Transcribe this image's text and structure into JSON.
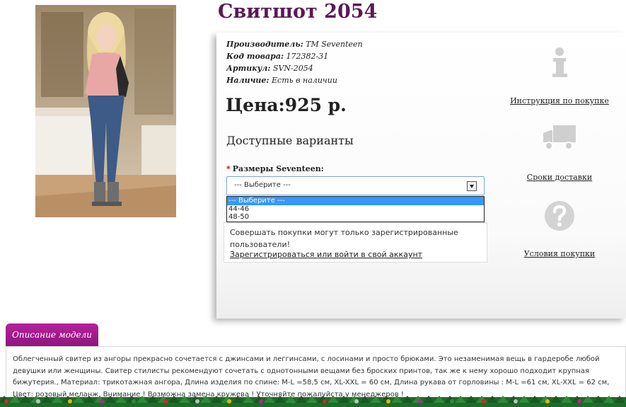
{
  "product": {
    "title": "Свитшот 2054",
    "meta": [
      {
        "label": "Производитель:",
        "value": "TM Seventeen"
      },
      {
        "label": "Код товара:",
        "value": "172382-31"
      },
      {
        "label": "Артикул:",
        "value": "SVN-2054"
      },
      {
        "label": "Наличие:",
        "value": "Есть в наличии"
      }
    ],
    "price_label": "Цена:",
    "price_value": "925 р.",
    "variants_title": "Доступные варианты",
    "size_label": "Размеры Seventeen:",
    "required_mark": "*",
    "select_value": "--- Выберите ---",
    "size_options": [
      "--- Выберите ---",
      "44-46",
      "48-50"
    ],
    "notice_text": "Совершать покупки могут только зарегистрированные пользователи!",
    "login_link": "Зарегистрироваться или войти в свой аккаунт"
  },
  "side_links": [
    {
      "label": "Инструкция по покупке",
      "icon": "info-icon"
    },
    {
      "label": "Сроки доставки",
      "icon": "truck-icon"
    },
    {
      "label": "Условия покупки",
      "icon": "question-icon"
    }
  ],
  "description": {
    "tab_label": "Описание модели",
    "text": "Облегченный свитер из ангоры прекрасно сочетается с джинсами и леггинсами, с лосинами и просто брюками. Это незаменимая вещь в гардеробе любой девушки или женщины. Свитер стилисты рекомендуют сочетать с однотонными вещами без броских принтов, так же к нему хорошо подходит крупная бижутерия., Материал: трикотажная ангора, Длина изделия по спине: М-L =58,5 см, XL-XXL = 60 см, Длина рукава от горловины : M-L =61 см, XL-XXL = 62 см, Цвет: розовый меланж. Внимание ! Возможна замена кружева ! Уточняйте пожалуйста у менеджеров !"
  },
  "colors": {
    "title": "#5a1a55",
    "tab": "#a01d8e",
    "selected_option": "#3399ff",
    "select_border": "#7aa6d6"
  }
}
